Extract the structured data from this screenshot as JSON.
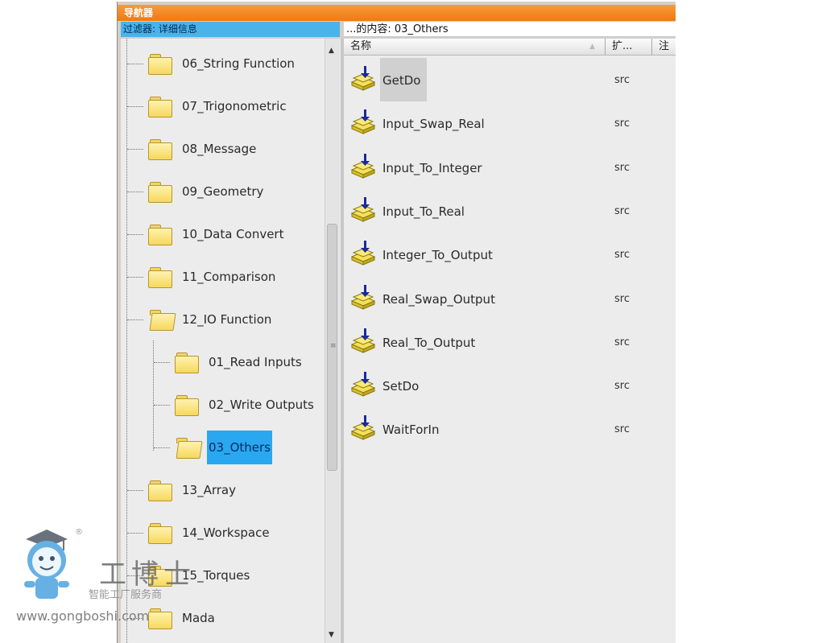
{
  "window": {
    "title": "导航器"
  },
  "filter_bar": {
    "label": "过滤器: 详细信息"
  },
  "content_bar": {
    "label": "...的内容: 03_Others"
  },
  "tree": {
    "items": [
      {
        "label": "06_String Function"
      },
      {
        "label": "07_Trigonometric"
      },
      {
        "label": "08_Message"
      },
      {
        "label": "09_Geometry"
      },
      {
        "label": "10_Data Convert"
      },
      {
        "label": "11_Comparison"
      },
      {
        "label": "12_IO Function",
        "expanded": true
      },
      {
        "label": "01_Read Inputs",
        "level": 2
      },
      {
        "label": "02_Write Outputs",
        "level": 2
      },
      {
        "label": "03_Others",
        "level": 2,
        "selected": true
      },
      {
        "label": "13_Array"
      },
      {
        "label": "14_Workspace"
      },
      {
        "label": "15_Torques"
      },
      {
        "label": "Mada"
      }
    ]
  },
  "list": {
    "columns": [
      "名称",
      "扩...",
      "注"
    ],
    "rows": [
      {
        "name": "GetDo",
        "ext": "src"
      },
      {
        "name": "Input_Swap_Real",
        "ext": "src"
      },
      {
        "name": "Input_To_Integer",
        "ext": "src"
      },
      {
        "name": "Input_To_Real",
        "ext": "src"
      },
      {
        "name": "Integer_To_Output",
        "ext": "src"
      },
      {
        "name": "Real_Swap_Output",
        "ext": "src"
      },
      {
        "name": "Real_To_Output",
        "ext": "src"
      },
      {
        "name": "SetDo",
        "ext": "src"
      },
      {
        "name": "WaitForIn",
        "ext": "src"
      }
    ]
  },
  "watermark": {
    "brand": "工博士",
    "tagline": "智能工厂服务商",
    "url": "www.gongboshi.com",
    "reg": "®"
  },
  "colors": {
    "titlebar": "#f07a10",
    "filter_bar": "#4ab3ea",
    "selection": "#29a8ef"
  }
}
